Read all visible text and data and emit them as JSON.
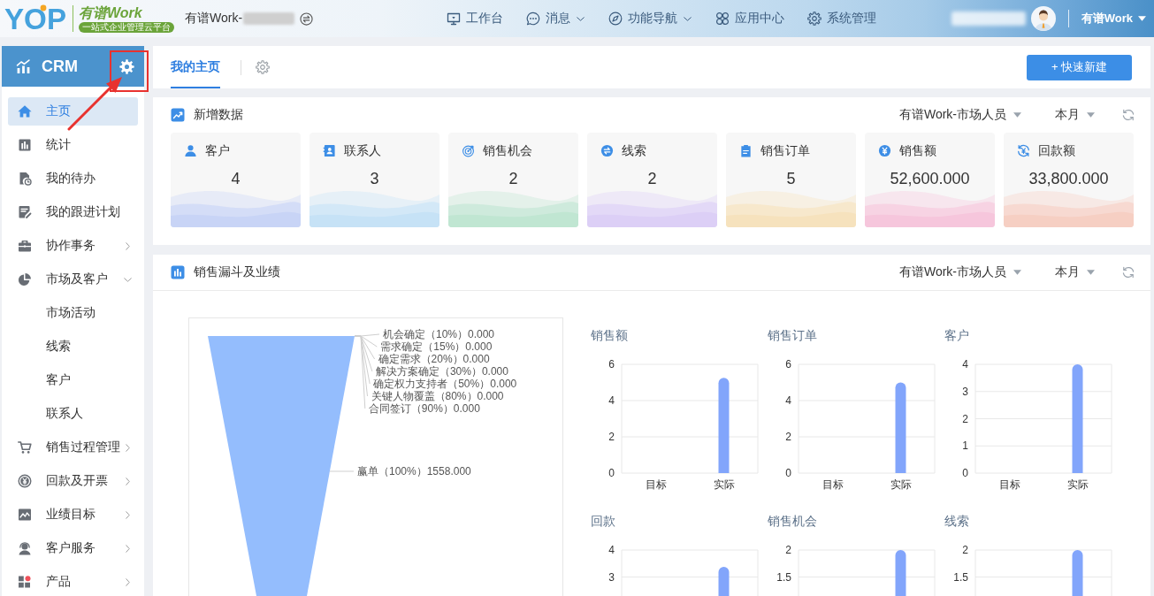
{
  "header": {
    "logo": {
      "mark": "YOP",
      "name": "有谱Work",
      "tagline": "一站式企业管理云平台"
    },
    "company": "有谱Work-",
    "nav": [
      {
        "label": "工作台",
        "dropdown": false
      },
      {
        "label": "消息",
        "dropdown": true
      },
      {
        "label": "功能导航",
        "dropdown": true
      },
      {
        "label": "应用中心",
        "dropdown": false
      },
      {
        "label": "系统管理",
        "dropdown": false
      }
    ],
    "user": "有谱Work"
  },
  "sidebar": {
    "title": "CRM",
    "items": [
      {
        "label": "主页",
        "selected": true
      },
      {
        "label": "统计",
        "selected": false
      },
      {
        "label": "我的待办",
        "selected": false
      },
      {
        "label": "我的跟进计划",
        "selected": false
      },
      {
        "label": "协作事务",
        "selected": false,
        "expanded": false
      },
      {
        "label": "市场及客户",
        "selected": false,
        "expanded": true,
        "children": [
          {
            "label": "市场活动",
            "selected": false
          },
          {
            "label": "线索",
            "selected": false
          },
          {
            "label": "客户",
            "selected": false
          },
          {
            "label": "联系人",
            "selected": false
          }
        ]
      },
      {
        "label": "销售过程管理",
        "selected": false,
        "expanded": false
      },
      {
        "label": "回款及开票",
        "selected": false,
        "expanded": false
      },
      {
        "label": "业绩目标",
        "selected": false,
        "expanded": false
      },
      {
        "label": "客户服务",
        "selected": false,
        "expanded": false
      },
      {
        "label": "产品",
        "selected": false,
        "expanded": false
      }
    ]
  },
  "tabs": [
    {
      "label": "我的主页",
      "selected": true
    }
  ],
  "quick_create": "+ 快速新建",
  "new_data_panel": {
    "title": "新增数据",
    "filters": [
      "有谱Work-市场人员",
      "本月"
    ],
    "stats": [
      {
        "label": "客户",
        "value": "4",
        "color": "#c8d4f6"
      },
      {
        "label": "联系人",
        "value": "3",
        "color": "#c6e2f6"
      },
      {
        "label": "销售机会",
        "value": "2",
        "color": "#c0e6d2"
      },
      {
        "label": "线索",
        "value": "2",
        "color": "#dccff6"
      },
      {
        "label": "销售订单",
        "value": "5",
        "color": "#f6e2bd"
      },
      {
        "label": "销售额",
        "value": "52,600.000",
        "color": "#f6c6dc"
      },
      {
        "label": "回款额",
        "value": "33,800.000",
        "color": "#f6cfc3"
      }
    ]
  },
  "funnel_panel": {
    "title": "销售漏斗及业绩",
    "filters": [
      "有谱Work-市场人员",
      "本月"
    ],
    "funnel": {
      "stages": [
        {
          "label": "机会确定（10%）0.000",
          "kind": "zero"
        },
        {
          "label": "需求确定（15%）0.000",
          "kind": "zero"
        },
        {
          "label": "确定需求（20%）0.000",
          "kind": "zero"
        },
        {
          "label": "解决方案确定（30%）0.000",
          "kind": "zero"
        },
        {
          "label": "确定权力支持者（50%）0.000",
          "kind": "zero"
        },
        {
          "label": "关键人物覆盖（80%）0.000",
          "kind": "zero"
        },
        {
          "label": "合同签订（90%）0.000",
          "kind": "zero"
        },
        {
          "label": "赢单（100%）1558.000",
          "kind": "main"
        }
      ]
    },
    "charts": [
      {
        "chart_data": {
          "type": "bar",
          "title": "销售额",
          "categories": [
            "目标",
            "实际"
          ],
          "values": [
            0,
            5.26
          ],
          "ylim": [
            0,
            6
          ],
          "yticks": [
            0,
            2,
            4,
            6
          ],
          "grid": true
        }
      },
      {
        "chart_data": {
          "type": "bar",
          "title": "销售订单",
          "categories": [
            "目标",
            "实际"
          ],
          "values": [
            0,
            5
          ],
          "ylim": [
            0,
            6
          ],
          "yticks": [
            0,
            2,
            4,
            6
          ],
          "grid": true
        }
      },
      {
        "chart_data": {
          "type": "bar",
          "title": "客户",
          "categories": [
            "目标",
            "实际"
          ],
          "values": [
            0,
            4
          ],
          "ylim": [
            0,
            4
          ],
          "yticks": [
            0,
            1,
            2,
            3,
            4
          ],
          "grid": true
        }
      },
      {
        "chart_data": {
          "type": "bar",
          "title": "回款",
          "values": [
            null,
            3.38
          ],
          "ylim": [
            2.3,
            4
          ],
          "yticks": [
            3,
            4
          ],
          "grid": true
        }
      },
      {
        "chart_data": {
          "type": "bar",
          "title": "销售机会",
          "values": [
            null,
            2
          ],
          "ylim": [
            1.15,
            2
          ],
          "yticks": [
            1.5,
            2
          ],
          "grid": true
        }
      },
      {
        "chart_data": {
          "type": "bar",
          "title": "线索",
          "values": [
            null,
            2
          ],
          "ylim": [
            1.15,
            2
          ],
          "yticks": [
            1.5,
            2
          ],
          "grid": true
        }
      }
    ]
  }
}
